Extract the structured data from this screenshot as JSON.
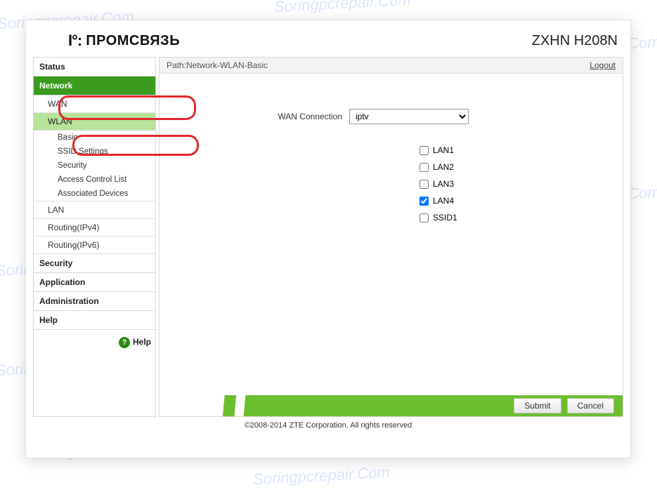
{
  "watermark_text": "Soringpcrepair.Com",
  "header": {
    "logo_text": "ПРОМСВЯЗЬ",
    "model": "ZXHN H208N"
  },
  "sidebar": {
    "items": [
      {
        "label": "Status",
        "type": "top"
      },
      {
        "label": "Network",
        "type": "top",
        "active": true
      },
      {
        "label": "WAN",
        "type": "sub"
      },
      {
        "label": "WLAN",
        "type": "sub",
        "selected": true
      },
      {
        "label": "Basic",
        "type": "subsub"
      },
      {
        "label": "SSID Settings",
        "type": "subsub"
      },
      {
        "label": "Security",
        "type": "subsub"
      },
      {
        "label": "Access Control List",
        "type": "subsub"
      },
      {
        "label": "Associated Devices",
        "type": "subsub"
      },
      {
        "label": "LAN",
        "type": "sub"
      },
      {
        "label": "Routing(IPv4)",
        "type": "sub"
      },
      {
        "label": "Routing(IPv6)",
        "type": "sub"
      },
      {
        "label": "Security",
        "type": "top"
      },
      {
        "label": "Application",
        "type": "top"
      },
      {
        "label": "Administration",
        "type": "top"
      },
      {
        "label": "Help",
        "type": "top"
      }
    ],
    "help_label": "Help"
  },
  "main": {
    "path_label": "Path:Network-WLAN-Basic",
    "logout_label": "Logout",
    "wan_label": "WAN Connection",
    "wan_selected": "iptv",
    "checks": [
      {
        "label": "LAN1",
        "checked": false
      },
      {
        "label": "LAN2",
        "checked": false
      },
      {
        "label": "LAN3",
        "checked": false
      },
      {
        "label": "LAN4",
        "checked": true
      },
      {
        "label": "SSID1",
        "checked": false
      }
    ],
    "submit_label": "Submit",
    "cancel_label": "Cancel"
  },
  "footer": {
    "copyright": "©2008-2014 ZTE Corporation. All rights reserved"
  }
}
